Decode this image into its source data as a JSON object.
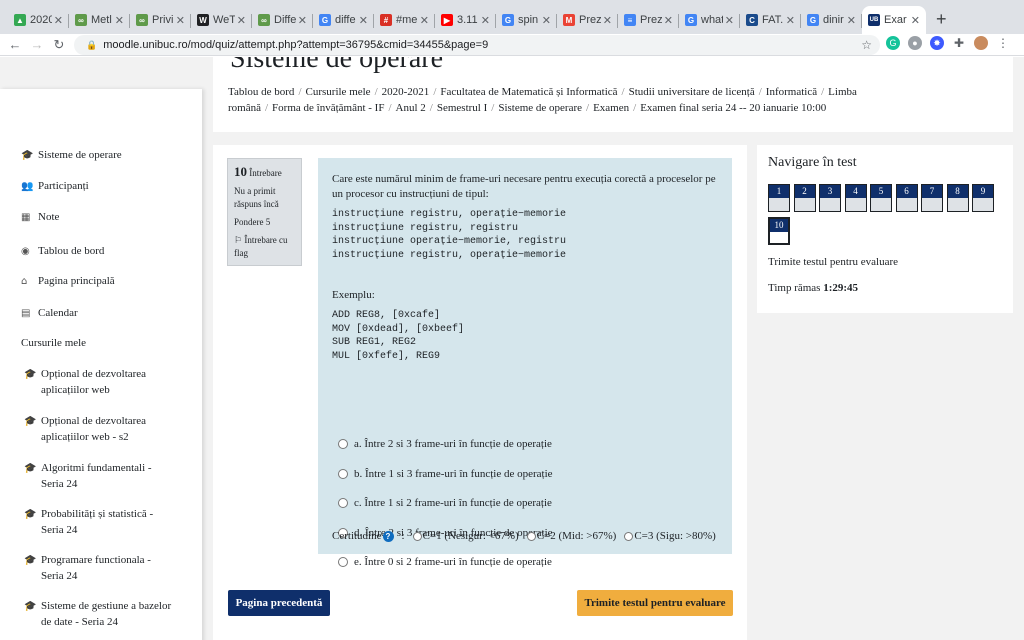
{
  "browser": {
    "tabs": [
      {
        "label": "2020",
        "color": "#34a853",
        "glyph": "▲"
      },
      {
        "label": "Metl",
        "color": "#5f9a4a",
        "glyph": "∞"
      },
      {
        "label": "Privi",
        "color": "#5f9a4a",
        "glyph": "∞"
      },
      {
        "label": "WeT",
        "color": "#202124",
        "glyph": "W"
      },
      {
        "label": "Diffe",
        "color": "#5f9a4a",
        "glyph": "∞"
      },
      {
        "label": "diffe",
        "color": "#4285f4",
        "glyph": "G"
      },
      {
        "label": "#me",
        "color": "#d93025",
        "glyph": "#"
      },
      {
        "label": "3.11",
        "color": "#ff0000",
        "glyph": "▶"
      },
      {
        "label": "spin",
        "color": "#4285f4",
        "glyph": "G"
      },
      {
        "label": "Prez",
        "color": "#ea4335",
        "glyph": "M"
      },
      {
        "label": "Prez",
        "color": "#4285f4",
        "glyph": "≡"
      },
      {
        "label": "what",
        "color": "#4285f4",
        "glyph": "G"
      },
      {
        "label": "FAT.",
        "color": "#1a4b8c",
        "glyph": "C"
      },
      {
        "label": "dinir",
        "color": "#4285f4",
        "glyph": "G"
      },
      {
        "label": "Exar",
        "color": "#0f2f6b",
        "glyph": "UB",
        "active": true
      }
    ],
    "url": "moodle.unibuc.ro/mod/quiz/attempt.php?attempt=36795&cmid=34455&page=9"
  },
  "page_title": "Sisteme de operare",
  "breadcrumb": [
    "Tablou de bord",
    "Cursurile mele",
    "2020-2021",
    "Facultatea de Matematică și Informatică",
    "Studii universitare de licență",
    "Informatică",
    "Limba română",
    "Forma de învățământ - IF",
    "Anul 2",
    "Semestrul I",
    "Sisteme de operare",
    "Examen",
    "Examen final seria 24 -- 20 ianuarie 10:00"
  ],
  "sidebar": {
    "items": [
      {
        "label": "Sisteme de operare",
        "icon": "graduation-cap-icon",
        "glyph": "🎓"
      },
      {
        "label": "Participanți",
        "icon": "users-icon",
        "glyph": "👥"
      },
      {
        "label": "Note",
        "icon": "table-icon",
        "glyph": "▦"
      },
      {
        "label": "Tablou de bord",
        "icon": "dashboard-icon",
        "glyph": "◉"
      },
      {
        "label": "Pagina principală",
        "icon": "home-icon",
        "glyph": "⌂"
      },
      {
        "label": "Calendar",
        "icon": "calendar-icon",
        "glyph": "▤"
      }
    ],
    "section": "Cursurile mele",
    "courses": [
      {
        "line1": "Opțional de dezvoltarea",
        "line2": "aplicațiilor web"
      },
      {
        "line1": "Opțional de dezvoltarea",
        "line2": "aplicațiilor web - s2"
      },
      {
        "line1": "Algoritmi fundamentali -",
        "line2": "Seria 24"
      },
      {
        "line1": "Probabilități și statistică -",
        "line2": "Seria 24"
      },
      {
        "line1": "Programare functionala -",
        "line2": "Seria 24"
      },
      {
        "line1": "Sisteme de gestiune a bazelor",
        "line2": "de date - Seria 24"
      },
      {
        "line1": "Sisteme de operare",
        "line2": ""
      }
    ]
  },
  "question_info": {
    "number": "10",
    "label": "Întrebare",
    "status": "Nu a primit răspuns încă",
    "weight": "Pondere 5",
    "flag": "Întrebare cu flag"
  },
  "question": {
    "text": "Care este numărul minim de frame-uri necesare pentru execuția corectă a proceselor pe un procesor cu instrucțiuni de tipul:",
    "code1": "instrucțiune registru, operație−memorie\ninstrucțiune registru, registru\ninstrucțiune operație−memorie, registru\ninstrucțiune registru, operație−memorie",
    "example_label": "Exemplu:",
    "code2": "ADD REG8, [0xcafe]\nMOV [0xdead], [0xbeef]\nSUB REG1, REG2\nMUL [0xfefe], REG9",
    "options": [
      "a. Între 2 si 3 frame-uri în funcție de operație",
      "b. Între 1 si 3 frame-uri în funcție de operație",
      "c. Între 1 si 2 frame-uri în funcție de operație",
      "d. Între 2 si 3 frame-uri în funcție de operație",
      "e. Între 0 si 2 frame-uri în funcție de operație"
    ],
    "certainty_label": "Certitudine",
    "certainty_options": [
      "C=1 (Nesigur: <67%)",
      "C=2 (Mid: >67%)",
      "C=3 (Sigu: >80%)"
    ]
  },
  "buttons": {
    "prev": "Pagina precedentă",
    "submit": "Trimite testul pentru evaluare"
  },
  "nav": {
    "title": "Navigare în test",
    "pages": [
      "1",
      "2",
      "3",
      "4",
      "5",
      "6",
      "7",
      "8",
      "9",
      "10"
    ],
    "current": "10",
    "submit_link": "Trimite testul pentru evaluare",
    "time_label": "Timp rămas",
    "time_value": "1:29:45"
  },
  "colors": {
    "navy": "#0f2f6b",
    "question_bg": "#d5e6ec",
    "submit_bg": "#f0ad3e"
  }
}
